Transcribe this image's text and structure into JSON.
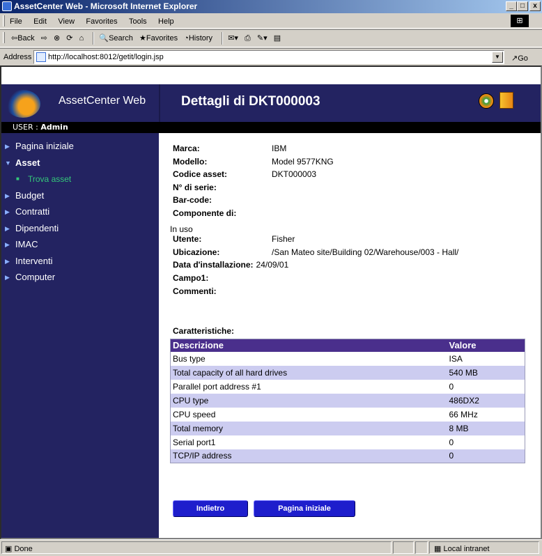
{
  "window": {
    "title": "AssetCenter Web - Microsoft Internet Explorer",
    "minimize": "_",
    "maximize": "□",
    "close": "x"
  },
  "menu": [
    "File",
    "Edit",
    "View",
    "Favorites",
    "Tools",
    "Help"
  ],
  "toolbar": {
    "back": "⇦Back",
    "forward": "⇨",
    "stop": "⊗",
    "refresh": "⟳",
    "home": "⌂",
    "search": "Search",
    "favorites": "Favorites",
    "history": "History"
  },
  "address": {
    "label": "Address",
    "url": "http://localhost:8012/getit/login.jsp",
    "go": "Go"
  },
  "header": {
    "app_name": "AssetCenter Web",
    "page_title": "Dettagli di DKT000003"
  },
  "user": {
    "label": "USER : ",
    "name": "Admin"
  },
  "sidebar": {
    "items": [
      {
        "label": "Pagina iniziale"
      },
      {
        "label": "Asset"
      },
      {
        "label": "Trova asset"
      },
      {
        "label": "Budget"
      },
      {
        "label": "Contratti"
      },
      {
        "label": "Dipendenti"
      },
      {
        "label": "IMAC"
      },
      {
        "label": "Interventi"
      },
      {
        "label": "Computer"
      }
    ]
  },
  "details": {
    "marca": {
      "label": "Marca:",
      "value": "IBM"
    },
    "modello": {
      "label": "Modello:",
      "value": "Model 9577KNG"
    },
    "codice": {
      "label": "Codice asset:",
      "value": "DKT000003"
    },
    "serie": {
      "label": "N° di serie:",
      "value": ""
    },
    "barcode": {
      "label": "Bar-code:",
      "value": ""
    },
    "componente": {
      "label": "Componente di:",
      "value": ""
    },
    "stato": "In uso",
    "utente": {
      "label": "Utente:",
      "value": "Fisher"
    },
    "ubicazione": {
      "label": "Ubicazione:",
      "value": "/San Mateo site/Building 02/Warehouse/003 - Hall/"
    },
    "data": {
      "label": "Data d'installazione:",
      "value": "24/09/01"
    },
    "campo1": {
      "label": "Campo1:",
      "value": ""
    },
    "commenti": {
      "label": "Commenti:",
      "value": ""
    }
  },
  "caratteristiche": {
    "title": "Caratteristiche:",
    "headers": {
      "desc": "Descrizione",
      "val": "Valore"
    },
    "rows": [
      {
        "desc": "Bus type",
        "val": "ISA"
      },
      {
        "desc": "Total capacity of all hard drives",
        "val": "540 MB"
      },
      {
        "desc": "Parallel port address #1",
        "val": "0"
      },
      {
        "desc": "CPU type",
        "val": "486DX2"
      },
      {
        "desc": "CPU speed",
        "val": "66 MHz"
      },
      {
        "desc": "Total memory",
        "val": "8 MB"
      },
      {
        "desc": "Serial port1",
        "val": "0"
      },
      {
        "desc": "TCP/IP address",
        "val": "0"
      }
    ]
  },
  "buttons": {
    "back": "Indietro",
    "home": "Pagina iniziale"
  },
  "status": {
    "text": "Done",
    "zone": "Local intranet"
  }
}
